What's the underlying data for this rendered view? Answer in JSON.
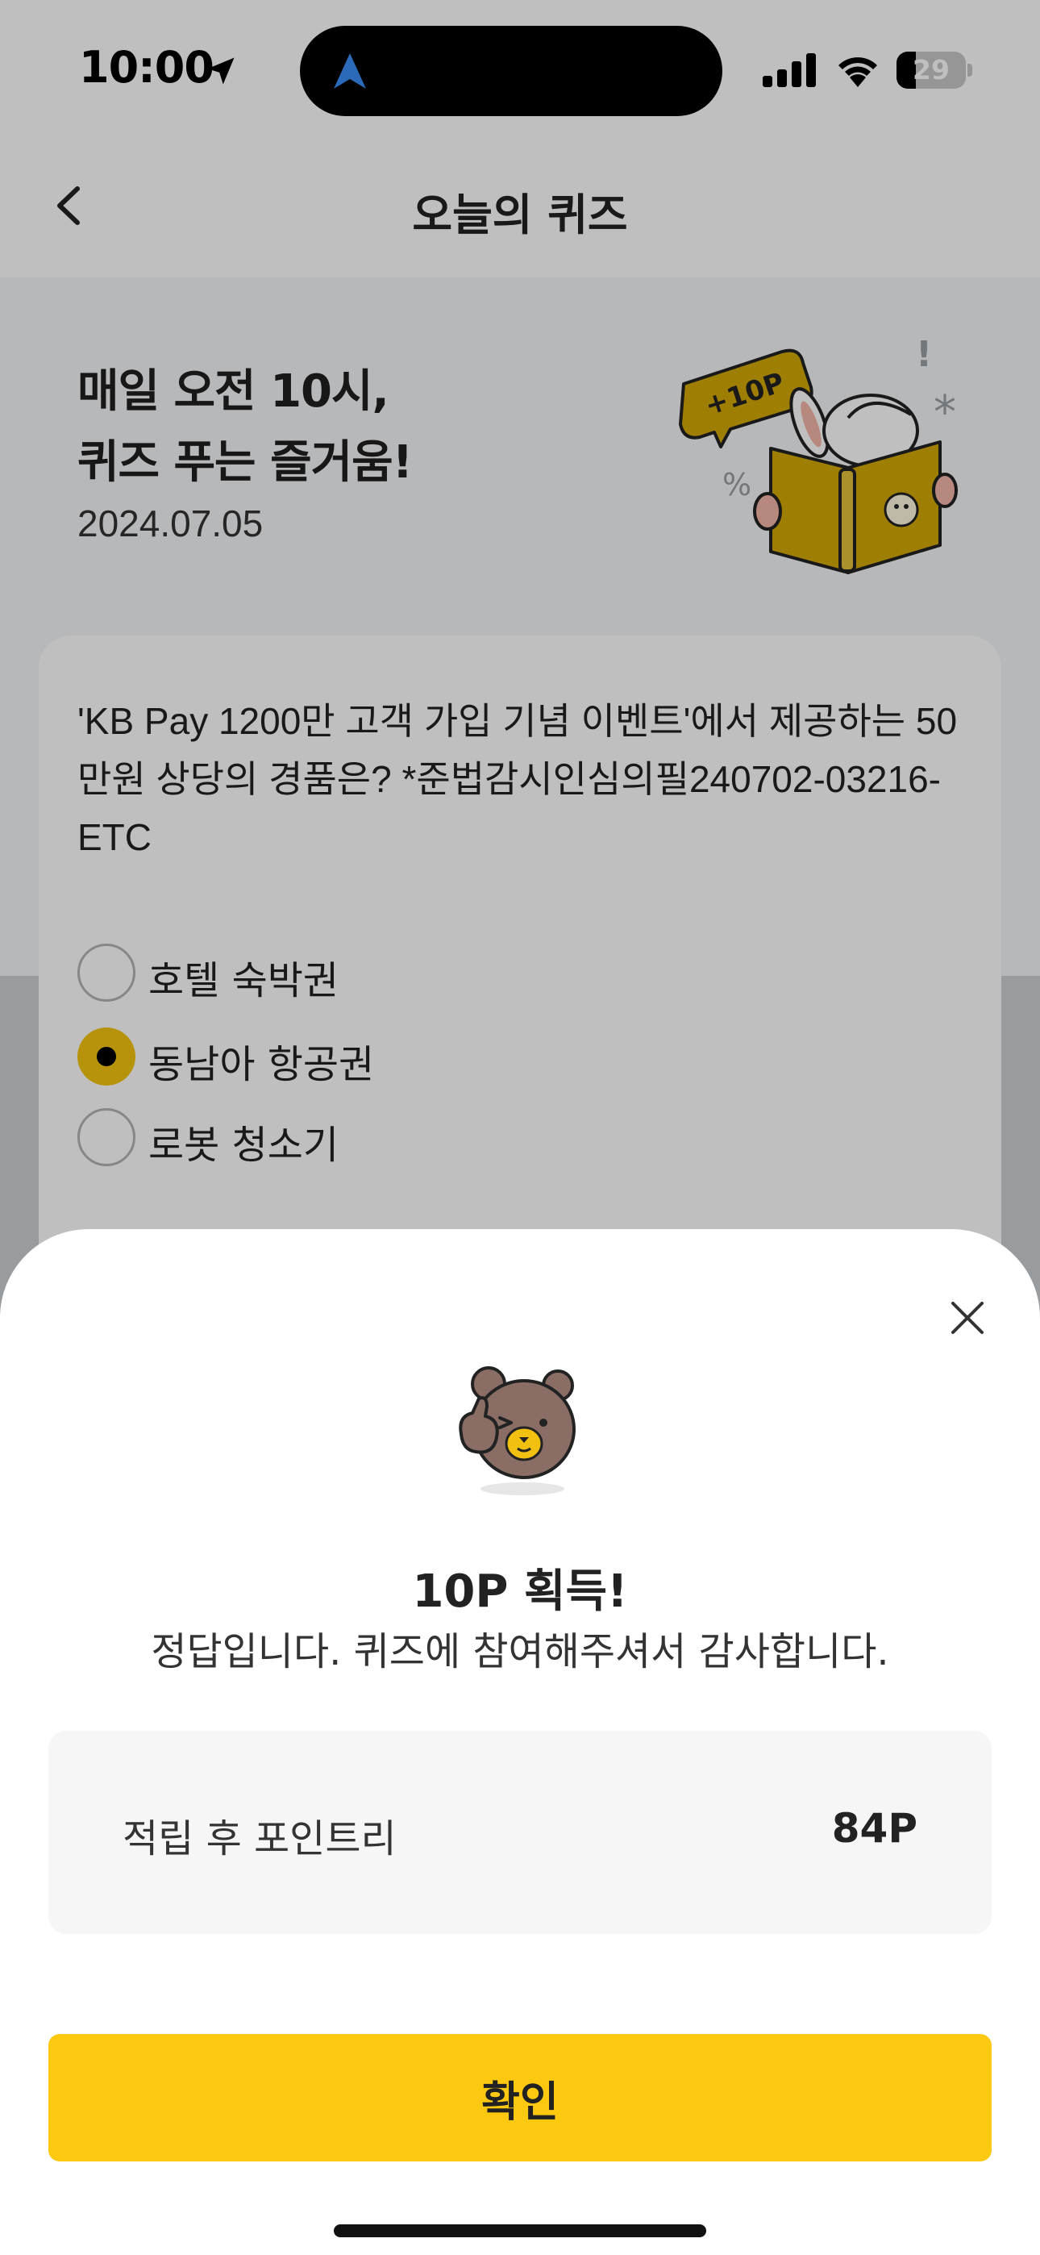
{
  "status_bar": {
    "time": "10:00",
    "battery": "29"
  },
  "nav": {
    "title": "오늘의 퀴즈"
  },
  "hero": {
    "headline_line1": "매일 오전 10시,",
    "headline_line2": "퀴즈 푸는 즐거움!",
    "date": "2024.07.05",
    "badge": "+10P"
  },
  "quiz": {
    "question": "'KB Pay 1200만 고객 가입 기념 이벤트'에서 제공하는 50만원 상당의 경품은? *준법감시인심의필240702-03216-ETC",
    "options": [
      {
        "label": "호텔 숙박권",
        "selected": false
      },
      {
        "label": "동남아 항공권",
        "selected": true
      },
      {
        "label": "로봇 청소기",
        "selected": false
      }
    ]
  },
  "sheet": {
    "title": "10P 획득!",
    "subtitle": "정답입니다. 퀴즈에 참여해주셔서 감사합니다.",
    "points_label": "적립 후 포인트리",
    "points_value": "84P",
    "confirm_label": "확인"
  },
  "colors": {
    "accent": "#fdc810",
    "radio_selected": "#f4c40f",
    "bear": "#8a6e66"
  },
  "icons": [
    "location-arrow-icon",
    "navigation-icon",
    "signal-icon",
    "wifi-icon",
    "battery-icon",
    "back-chevron-icon",
    "close-icon",
    "bear-thumbs-up-icon"
  ]
}
